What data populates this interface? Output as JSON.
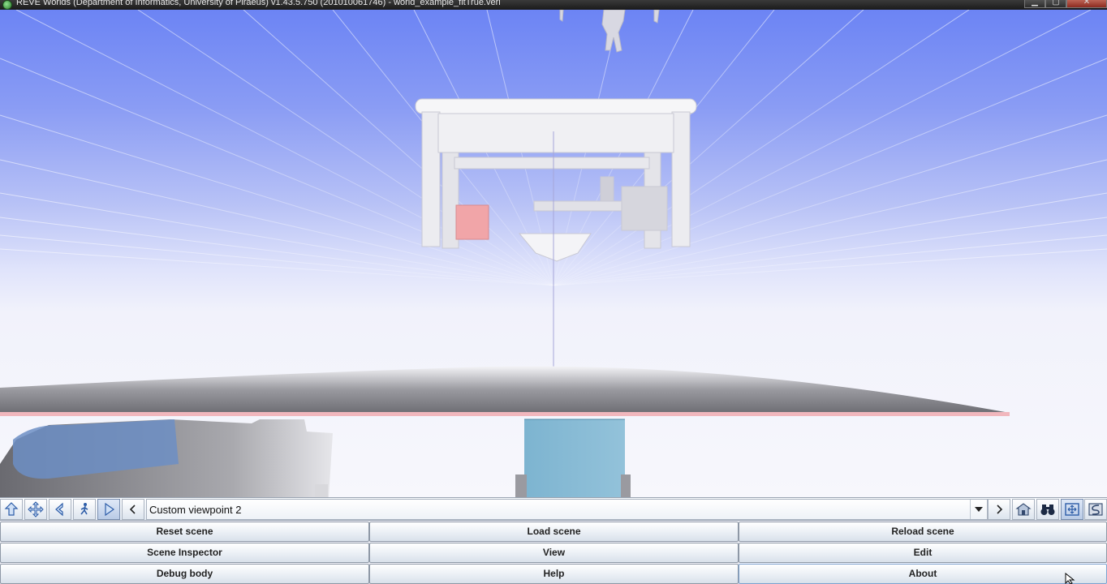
{
  "window": {
    "title": "REVE Worlds (Department of Informatics, University of Piraeus) v1.43.5.750 (201010061746) - world_example_fitTrue.verl",
    "controls": [
      "minimize-icon",
      "maximize-icon",
      "close-icon"
    ]
  },
  "viewport": {
    "sky_color": "#6c84f4",
    "floor_color": "#f4f4fb"
  },
  "nav": {
    "left_tools": [
      "fly-icon",
      "pan-icon",
      "turn-icon",
      "walk-icon",
      "examine-icon"
    ],
    "prev_viewpoint_icon": "chevron-left-icon",
    "viewpoint": "Custom viewpoint 2",
    "dropdown_icon": "chevron-down-icon",
    "next_viewpoint_icon": "chevron-right-icon",
    "right_tools": [
      "home-icon",
      "binoculars-icon",
      "fit-view-icon",
      "straighten-icon"
    ]
  },
  "buttons": {
    "reset_scene": "Reset scene",
    "load_scene": "Load scene",
    "reload_scene": "Reload scene",
    "scene_inspector": "Scene Inspector",
    "view": "View",
    "edit": "Edit",
    "debug_body": "Debug body",
    "help": "Help",
    "about": "About"
  }
}
